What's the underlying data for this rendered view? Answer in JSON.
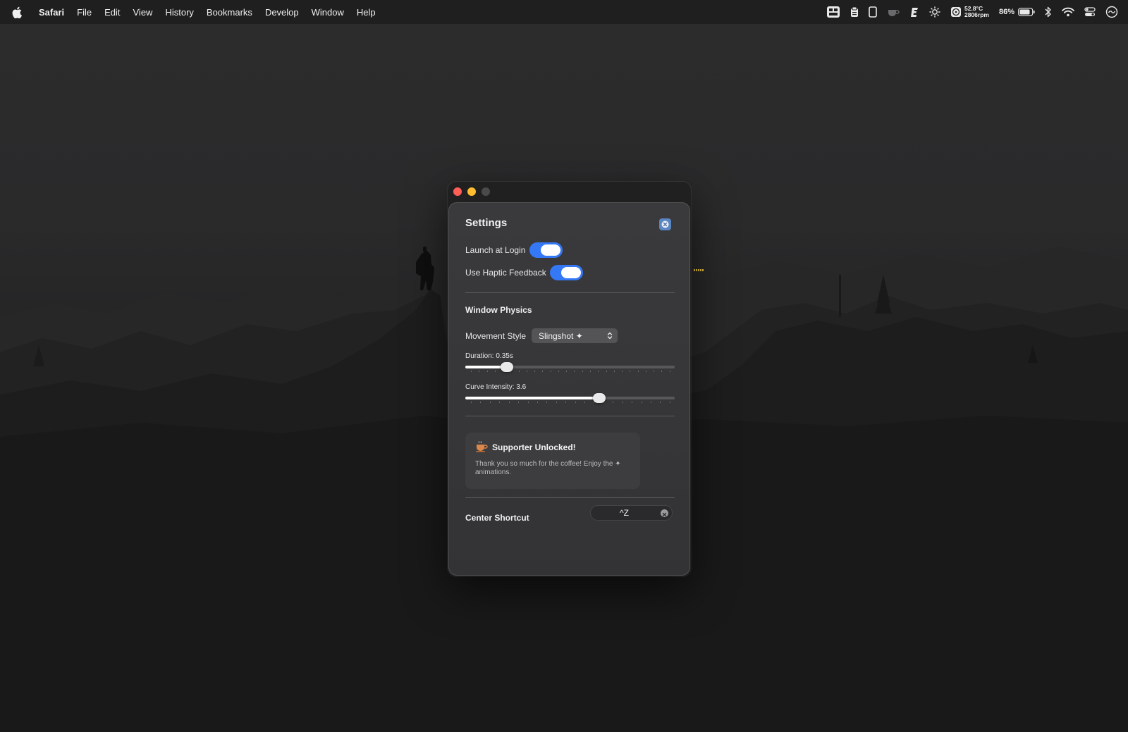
{
  "menubar": {
    "app_name": "Safari",
    "items": [
      "File",
      "Edit",
      "View",
      "History",
      "Bookmarks",
      "Develop",
      "Window",
      "Help"
    ],
    "status": {
      "temperature": "52.8°C",
      "fan_speed": "2806rpm",
      "battery_percent": "86%",
      "icons": [
        "window-switcher-icon",
        "clipboard-icon",
        "phone-icon",
        "coffee-cup-icon",
        "pen-icon",
        "brightness-icon",
        "fan-icon",
        "battery-icon",
        "bluetooth-icon",
        "wifi-icon",
        "control-center-icon",
        "siri-icon"
      ]
    }
  },
  "window": {
    "title": "Settings",
    "general": {
      "launch_at_login": {
        "label": "Launch at Login",
        "enabled": true
      },
      "haptic_feedback": {
        "label": "Use Haptic Feedback",
        "enabled": true
      }
    },
    "physics": {
      "section_title": "Window Physics",
      "movement_style": {
        "label": "Movement Style",
        "value": "Slingshot ✦"
      },
      "duration": {
        "label": "Duration: 0.35s",
        "value": 0.35,
        "fraction": 0.2
      },
      "curve_intensity": {
        "label": "Curve Intensity: 3.6",
        "value": 3.6,
        "fraction": 0.64
      }
    },
    "supporter": {
      "title": "Supporter Unlocked!",
      "message": "Thank you so much for the coffee! Enjoy the ✦ animations."
    },
    "shortcut": {
      "label": "Center Shortcut",
      "keys": "^Z"
    }
  },
  "colors": {
    "accent": "#3478f6",
    "close": "#ff5f57",
    "minimize": "#febc2e"
  }
}
